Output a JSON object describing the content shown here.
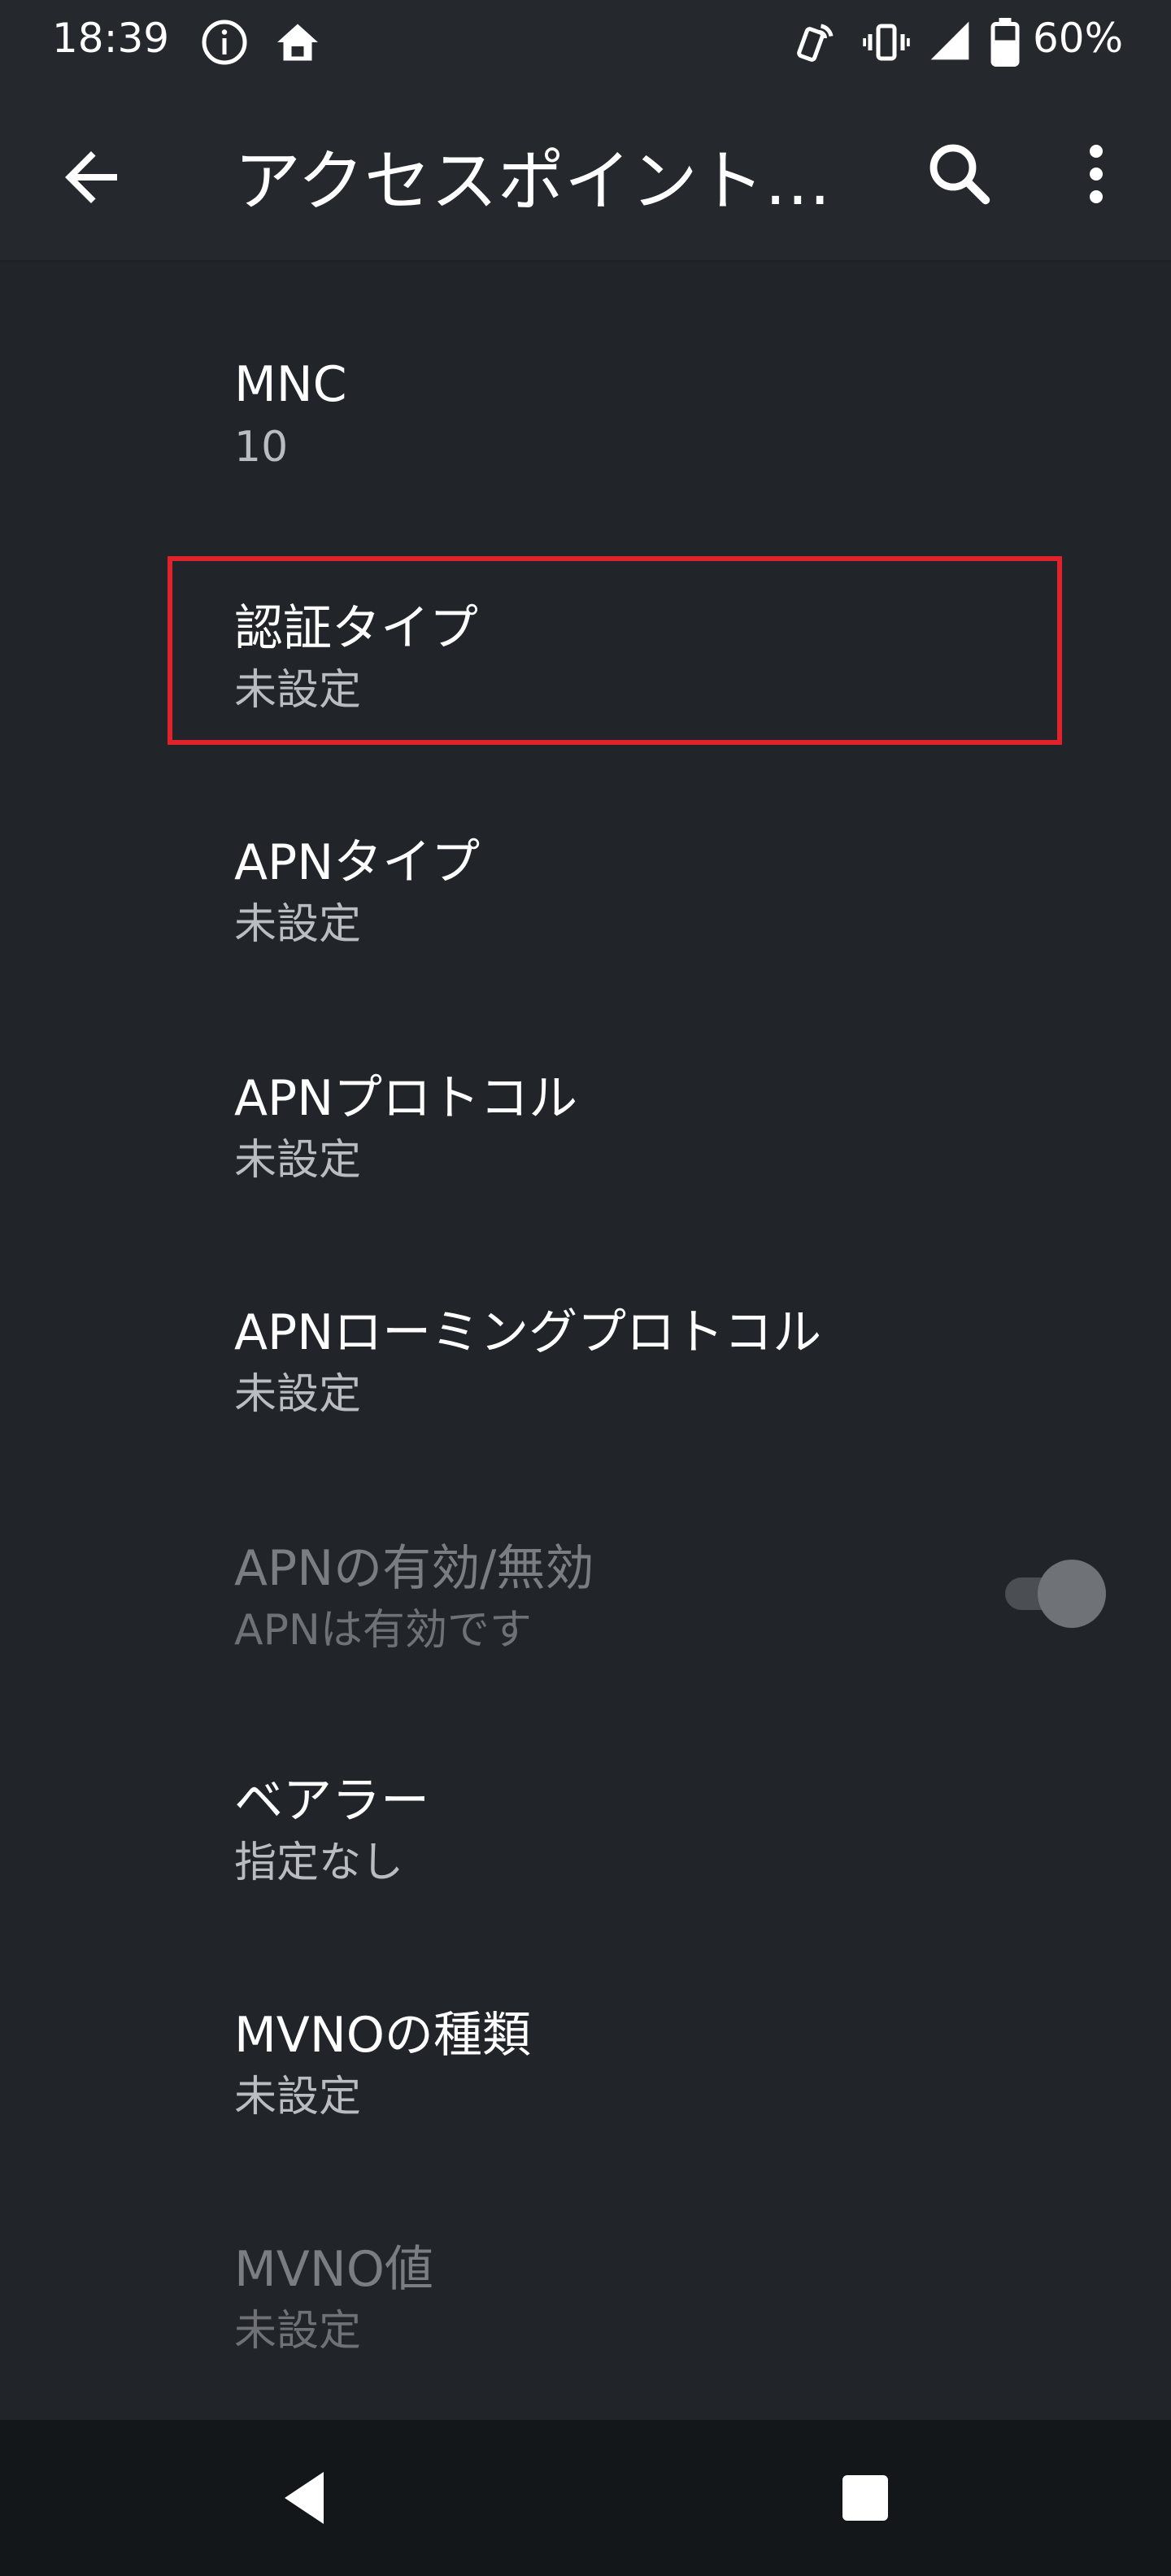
{
  "status_bar": {
    "time": "18:39",
    "battery_percent": "60%",
    "icons": [
      "info-icon",
      "home-icon",
      "nfc-icon",
      "vibrate-icon",
      "signal-icon",
      "battery-icon"
    ]
  },
  "app_bar": {
    "title": "アクセスポイント…",
    "back_icon": "arrow-back-icon",
    "search_icon": "search-icon",
    "more_icon": "more-vert-icon"
  },
  "settings": [
    {
      "title": "MNC",
      "summary": "10"
    },
    {
      "title": "認証タイプ",
      "summary": "未設定",
      "highlighted": true
    },
    {
      "title": "APNタイプ",
      "summary": "未設定"
    },
    {
      "title": "APNプロトコル",
      "summary": "未設定"
    },
    {
      "title": "APNローミングプロトコル",
      "summary": "未設定"
    },
    {
      "title": "APNの有効/無効",
      "summary": "APNは有効です",
      "disabled": true,
      "toggle_on": true
    },
    {
      "title": "ベアラー",
      "summary": "指定なし"
    },
    {
      "title": "MVNOの種類",
      "summary": "未設定"
    },
    {
      "title": "MVNO値",
      "summary": "未設定",
      "disabled": true
    }
  ],
  "colors": {
    "background": "#212429",
    "highlight_border": "#e1222b",
    "navigation_bar": "#14171a"
  },
  "nav_bar": {
    "icons": [
      "nav-back-icon",
      "nav-recents-icon"
    ]
  }
}
